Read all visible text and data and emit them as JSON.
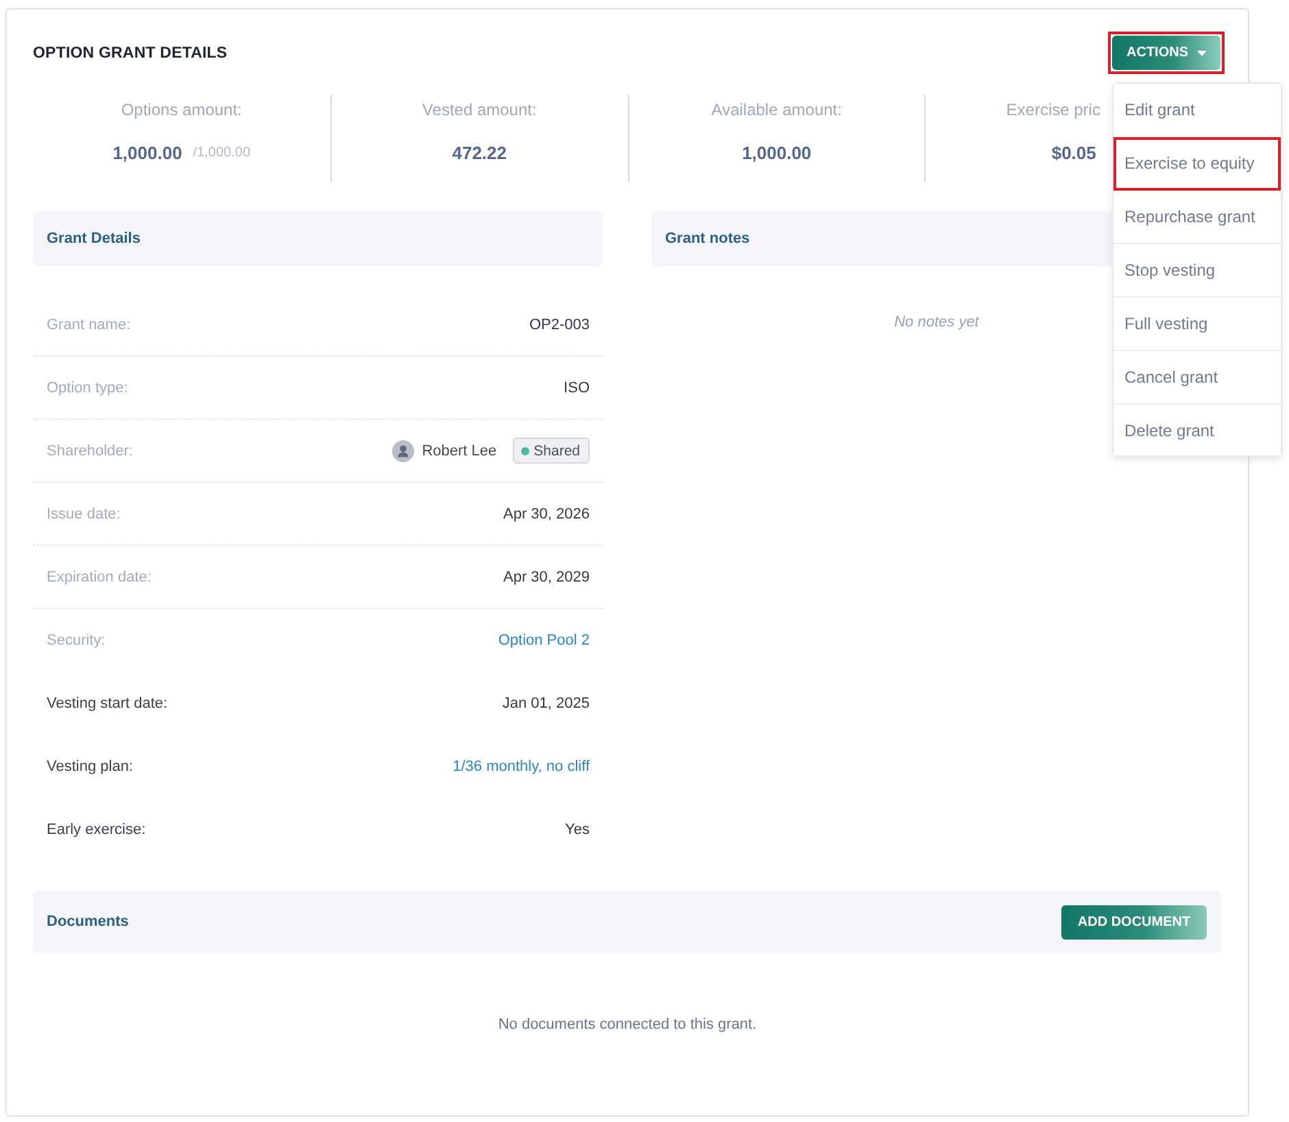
{
  "header": {
    "title": "OPTION GRANT DETAILS",
    "actions_button": {
      "label": "ACTIONS",
      "highlighted": true
    }
  },
  "actions_menu": {
    "items": [
      {
        "label": "Edit grant",
        "highlighted": false
      },
      {
        "label": "Exercise to equity",
        "highlighted": true
      },
      {
        "label": "Repurchase grant",
        "highlighted": false
      },
      {
        "label": "Stop vesting",
        "highlighted": false
      },
      {
        "label": "Full vesting",
        "highlighted": false
      },
      {
        "label": "Cancel grant",
        "highlighted": false
      },
      {
        "label": "Delete grant",
        "highlighted": false
      }
    ]
  },
  "stats": [
    {
      "label": "Options amount:",
      "value": "1,000.00",
      "total": "/1,000.00"
    },
    {
      "label": "Vested amount:",
      "value": "472.22"
    },
    {
      "label": "Available amount:",
      "value": "1,000.00"
    },
    {
      "label": "Exercise pric",
      "value": "$0.05"
    }
  ],
  "grant_details": {
    "title": "Grant Details",
    "rows": [
      {
        "label": "Grant name:",
        "muted": true,
        "divider": true,
        "kind": "text",
        "value": "OP2-003"
      },
      {
        "label": "Option type:",
        "muted": true,
        "divider": true,
        "kind": "text",
        "value": "ISO"
      },
      {
        "label": "Shareholder:",
        "muted": true,
        "divider": true,
        "kind": "person",
        "value": "Robert Lee",
        "tag": "Shared"
      },
      {
        "label": "Issue date:",
        "muted": true,
        "divider": true,
        "kind": "text",
        "value": "Apr 30, 2026"
      },
      {
        "label": "Expiration date:",
        "muted": true,
        "divider": true,
        "kind": "text",
        "value": "Apr 30, 2029"
      },
      {
        "label": "Security:",
        "muted": true,
        "divider": false,
        "kind": "link",
        "value": "Option Pool 2"
      },
      {
        "label": "Vesting start date:",
        "muted": false,
        "divider": false,
        "kind": "text",
        "value": "Jan 01, 2025"
      },
      {
        "label": "Vesting plan:",
        "muted": false,
        "divider": false,
        "kind": "link",
        "value": "1/36 monthly, no cliff"
      },
      {
        "label": "Early exercise:",
        "muted": false,
        "divider": false,
        "kind": "text",
        "value": "Yes"
      }
    ]
  },
  "grant_notes": {
    "title": "Grant notes",
    "empty_text": "No notes yet"
  },
  "documents": {
    "title": "Documents",
    "add_button": "ADD DOCUMENT",
    "empty_text": "No documents connected to this grant."
  }
}
